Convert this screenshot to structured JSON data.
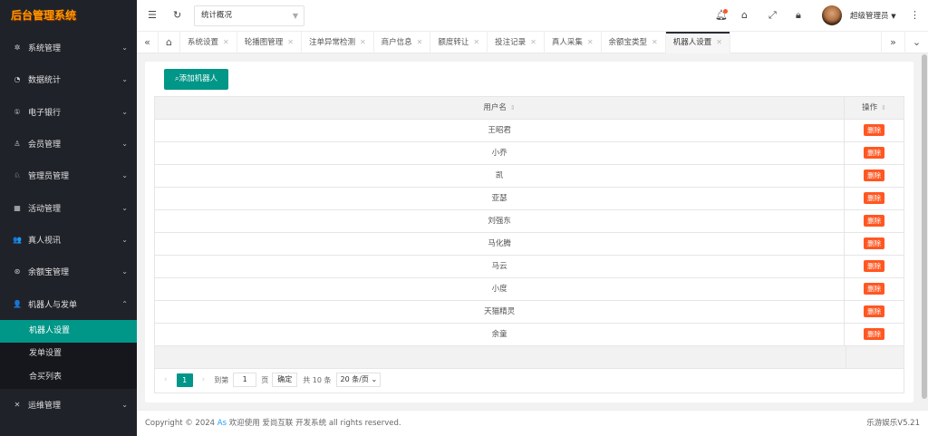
{
  "logo": "后台管理系统",
  "sidebar": {
    "items": [
      {
        "label": "系统管理",
        "icon": "gear-icon",
        "glyph": "✲"
      },
      {
        "label": "数据统计",
        "icon": "dashboard-icon",
        "glyph": "◔"
      },
      {
        "label": "电子银行",
        "icon": "bank-icon",
        "glyph": "①"
      },
      {
        "label": "会员管理",
        "icon": "members-icon",
        "glyph": "♙"
      },
      {
        "label": "管理员管理",
        "icon": "admin-icon",
        "glyph": "♘"
      },
      {
        "label": "活动管理",
        "icon": "gift-icon",
        "glyph": "▦"
      },
      {
        "label": "真人视讯",
        "icon": "users-icon",
        "glyph": "👥"
      },
      {
        "label": "余额宝管理",
        "icon": "wallet-icon",
        "glyph": "⊛"
      },
      {
        "label": "机器人与发单",
        "icon": "robot-icon",
        "glyph": "👤"
      }
    ],
    "submenu": [
      "机器人设置",
      "发单设置",
      "合买列表"
    ],
    "bottom_item": {
      "label": "运维管理",
      "icon": "ops-icon",
      "glyph": "✕"
    }
  },
  "topbar": {
    "select_value": "统计概况",
    "user_name": "超级管理员"
  },
  "tabs": [
    "系统设置",
    "轮播图管理",
    "注单异常检测",
    "商户信息",
    "额度转让",
    "投注记录",
    "真人采集",
    "余额宝类型",
    "机器人设置"
  ],
  "content": {
    "add_button": "添加机器人",
    "columns": {
      "user": "用户名",
      "op": "操作"
    },
    "sort_icon": "⇕",
    "delete_label": "删除",
    "rows": [
      "王昭君",
      "小乔",
      "凯",
      "亚瑟",
      "刘强东",
      "马化腾",
      "马云",
      "小度",
      "天猫精灵",
      "余童"
    ]
  },
  "pager": {
    "current": "1",
    "goto_label": "到第",
    "goto_value": "1",
    "page_unit": "页",
    "confirm": "确定",
    "total": "共 10 条",
    "page_size": "20 条/页"
  },
  "footer": {
    "copyright_pre": "Copyright © 2024",
    "as": "As",
    "copyright_post": "欢迎使用 爱尚互联 开发系统 all rights reserved.",
    "version": "乐游娱乐V5.21"
  },
  "colors": {
    "accent": "#009688",
    "danger": "#ff5722",
    "sidebar_bg": "#20222a"
  }
}
